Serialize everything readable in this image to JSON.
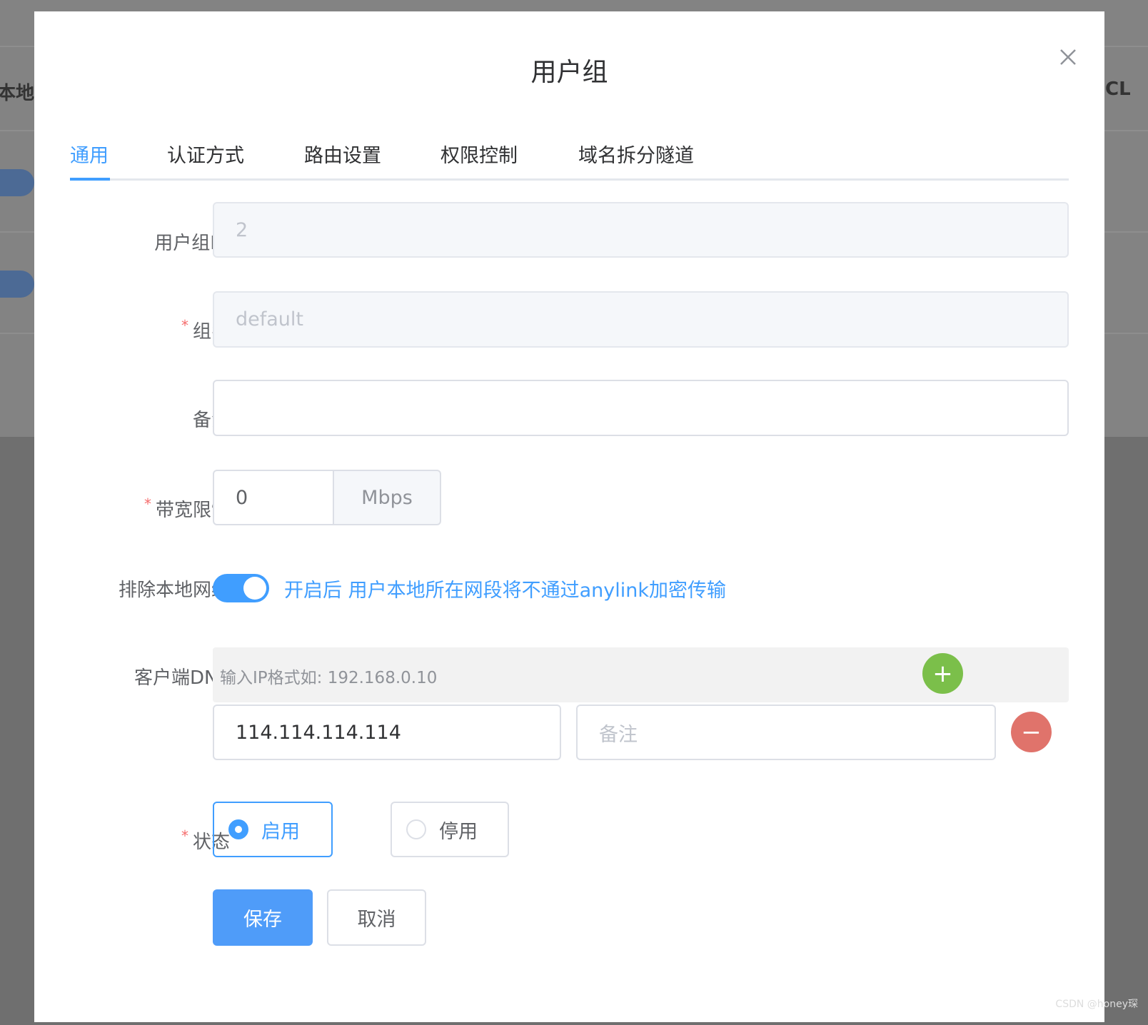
{
  "background": {
    "left_text": "本地",
    "right_text": "CL"
  },
  "dialog": {
    "title": "用户组",
    "tabs": [
      {
        "label": "通用",
        "active": true
      },
      {
        "label": "认证方式"
      },
      {
        "label": "路由设置"
      },
      {
        "label": "权限控制"
      },
      {
        "label": "域名拆分隧道"
      }
    ],
    "fields": {
      "group_id": {
        "label": "用户组ID",
        "value": "2"
      },
      "group_name": {
        "label": "组名",
        "value": "default",
        "required": true
      },
      "remark": {
        "label": "备注",
        "value": ""
      },
      "bandwidth": {
        "label": "带宽限制",
        "value": "0",
        "unit": "Mbps",
        "required": true
      },
      "exclude_local": {
        "label": "排除本地网络",
        "enabled": true,
        "hint": "开启后 用户本地所在网段将不通过anylink加密传输"
      },
      "client_dns": {
        "label": "客户端DNS",
        "hint": "输入IP格式如: 192.168.0.10",
        "entries": [
          {
            "ip": "114.114.114.114",
            "remark_placeholder": "备注"
          }
        ]
      },
      "status": {
        "label": "状态",
        "required": true,
        "options": [
          "启用",
          "停用"
        ],
        "selected": "启用"
      }
    },
    "buttons": {
      "save": "保存",
      "cancel": "取消"
    }
  },
  "colors": {
    "primary": "#409eff",
    "add": "#7bbf4a",
    "remove": "#e0736b"
  },
  "watermark": "CSDN @honey琛"
}
